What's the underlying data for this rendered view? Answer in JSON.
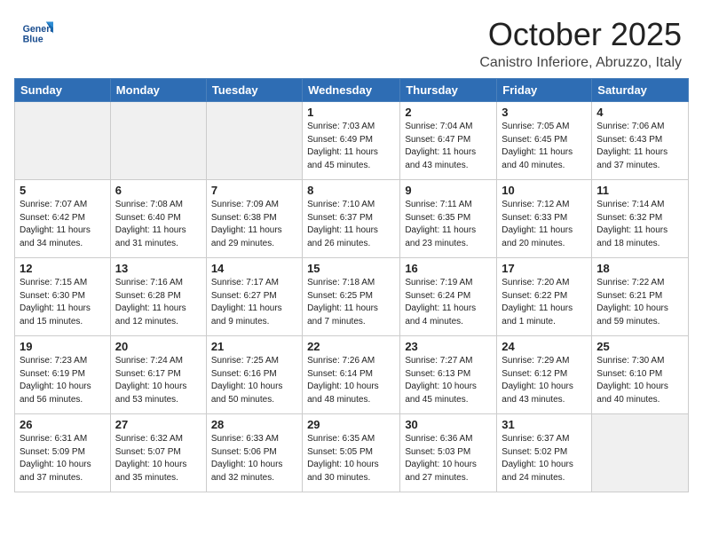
{
  "header": {
    "logo_text_general": "General",
    "logo_text_blue": "Blue",
    "month_title": "October 2025",
    "location": "Canistro Inferiore, Abruzzo, Italy"
  },
  "days_of_week": [
    "Sunday",
    "Monday",
    "Tuesday",
    "Wednesday",
    "Thursday",
    "Friday",
    "Saturday"
  ],
  "weeks": [
    [
      {
        "day": "",
        "info": "",
        "empty": true
      },
      {
        "day": "",
        "info": "",
        "empty": true
      },
      {
        "day": "",
        "info": "",
        "empty": true
      },
      {
        "day": "1",
        "info": "Sunrise: 7:03 AM\nSunset: 6:49 PM\nDaylight: 11 hours\nand 45 minutes.",
        "empty": false
      },
      {
        "day": "2",
        "info": "Sunrise: 7:04 AM\nSunset: 6:47 PM\nDaylight: 11 hours\nand 43 minutes.",
        "empty": false
      },
      {
        "day": "3",
        "info": "Sunrise: 7:05 AM\nSunset: 6:45 PM\nDaylight: 11 hours\nand 40 minutes.",
        "empty": false
      },
      {
        "day": "4",
        "info": "Sunrise: 7:06 AM\nSunset: 6:43 PM\nDaylight: 11 hours\nand 37 minutes.",
        "empty": false
      }
    ],
    [
      {
        "day": "5",
        "info": "Sunrise: 7:07 AM\nSunset: 6:42 PM\nDaylight: 11 hours\nand 34 minutes.",
        "empty": false
      },
      {
        "day": "6",
        "info": "Sunrise: 7:08 AM\nSunset: 6:40 PM\nDaylight: 11 hours\nand 31 minutes.",
        "empty": false
      },
      {
        "day": "7",
        "info": "Sunrise: 7:09 AM\nSunset: 6:38 PM\nDaylight: 11 hours\nand 29 minutes.",
        "empty": false
      },
      {
        "day": "8",
        "info": "Sunrise: 7:10 AM\nSunset: 6:37 PM\nDaylight: 11 hours\nand 26 minutes.",
        "empty": false
      },
      {
        "day": "9",
        "info": "Sunrise: 7:11 AM\nSunset: 6:35 PM\nDaylight: 11 hours\nand 23 minutes.",
        "empty": false
      },
      {
        "day": "10",
        "info": "Sunrise: 7:12 AM\nSunset: 6:33 PM\nDaylight: 11 hours\nand 20 minutes.",
        "empty": false
      },
      {
        "day": "11",
        "info": "Sunrise: 7:14 AM\nSunset: 6:32 PM\nDaylight: 11 hours\nand 18 minutes.",
        "empty": false
      }
    ],
    [
      {
        "day": "12",
        "info": "Sunrise: 7:15 AM\nSunset: 6:30 PM\nDaylight: 11 hours\nand 15 minutes.",
        "empty": false
      },
      {
        "day": "13",
        "info": "Sunrise: 7:16 AM\nSunset: 6:28 PM\nDaylight: 11 hours\nand 12 minutes.",
        "empty": false
      },
      {
        "day": "14",
        "info": "Sunrise: 7:17 AM\nSunset: 6:27 PM\nDaylight: 11 hours\nand 9 minutes.",
        "empty": false
      },
      {
        "day": "15",
        "info": "Sunrise: 7:18 AM\nSunset: 6:25 PM\nDaylight: 11 hours\nand 7 minutes.",
        "empty": false
      },
      {
        "day": "16",
        "info": "Sunrise: 7:19 AM\nSunset: 6:24 PM\nDaylight: 11 hours\nand 4 minutes.",
        "empty": false
      },
      {
        "day": "17",
        "info": "Sunrise: 7:20 AM\nSunset: 6:22 PM\nDaylight: 11 hours\nand 1 minute.",
        "empty": false
      },
      {
        "day": "18",
        "info": "Sunrise: 7:22 AM\nSunset: 6:21 PM\nDaylight: 10 hours\nand 59 minutes.",
        "empty": false
      }
    ],
    [
      {
        "day": "19",
        "info": "Sunrise: 7:23 AM\nSunset: 6:19 PM\nDaylight: 10 hours\nand 56 minutes.",
        "empty": false
      },
      {
        "day": "20",
        "info": "Sunrise: 7:24 AM\nSunset: 6:17 PM\nDaylight: 10 hours\nand 53 minutes.",
        "empty": false
      },
      {
        "day": "21",
        "info": "Sunrise: 7:25 AM\nSunset: 6:16 PM\nDaylight: 10 hours\nand 50 minutes.",
        "empty": false
      },
      {
        "day": "22",
        "info": "Sunrise: 7:26 AM\nSunset: 6:14 PM\nDaylight: 10 hours\nand 48 minutes.",
        "empty": false
      },
      {
        "day": "23",
        "info": "Sunrise: 7:27 AM\nSunset: 6:13 PM\nDaylight: 10 hours\nand 45 minutes.",
        "empty": false
      },
      {
        "day": "24",
        "info": "Sunrise: 7:29 AM\nSunset: 6:12 PM\nDaylight: 10 hours\nand 43 minutes.",
        "empty": false
      },
      {
        "day": "25",
        "info": "Sunrise: 7:30 AM\nSunset: 6:10 PM\nDaylight: 10 hours\nand 40 minutes.",
        "empty": false
      }
    ],
    [
      {
        "day": "26",
        "info": "Sunrise: 6:31 AM\nSunset: 5:09 PM\nDaylight: 10 hours\nand 37 minutes.",
        "empty": false
      },
      {
        "day": "27",
        "info": "Sunrise: 6:32 AM\nSunset: 5:07 PM\nDaylight: 10 hours\nand 35 minutes.",
        "empty": false
      },
      {
        "day": "28",
        "info": "Sunrise: 6:33 AM\nSunset: 5:06 PM\nDaylight: 10 hours\nand 32 minutes.",
        "empty": false
      },
      {
        "day": "29",
        "info": "Sunrise: 6:35 AM\nSunset: 5:05 PM\nDaylight: 10 hours\nand 30 minutes.",
        "empty": false
      },
      {
        "day": "30",
        "info": "Sunrise: 6:36 AM\nSunset: 5:03 PM\nDaylight: 10 hours\nand 27 minutes.",
        "empty": false
      },
      {
        "day": "31",
        "info": "Sunrise: 6:37 AM\nSunset: 5:02 PM\nDaylight: 10 hours\nand 24 minutes.",
        "empty": false
      },
      {
        "day": "",
        "info": "",
        "empty": true
      }
    ]
  ]
}
